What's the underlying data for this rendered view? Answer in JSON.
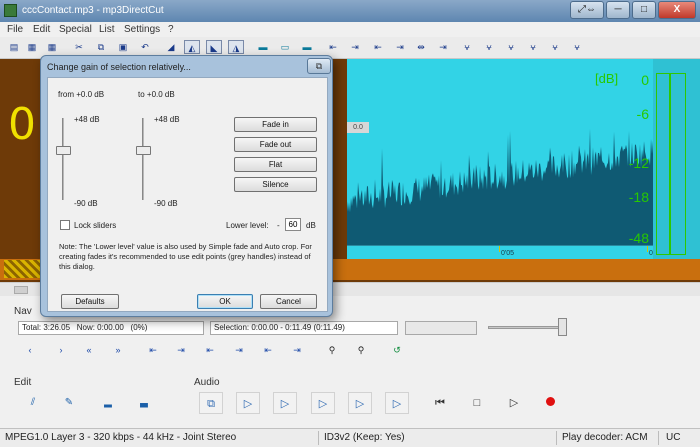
{
  "window": {
    "title": "cccContact.mp3 - mp3DirectCut",
    "btn_extra": "⤢⇔",
    "btn_min": "─",
    "btn_max": "□",
    "btn_close": "X"
  },
  "menu": [
    "File",
    "Edit",
    "Special",
    "List",
    "Settings",
    "?"
  ],
  "editor": {
    "big_time": "0",
    "db_title": "[dB]",
    "db_values": [
      "0",
      "-6",
      "-12",
      "-18",
      "-48"
    ],
    "playhead_label": "0.0",
    "timeline_labels": [
      "0'05",
      "0'10"
    ]
  },
  "nav": {
    "label": "Nav",
    "total": "Total: 3:26.05",
    "now": "Now: 0:00.00",
    "percent": "(0%)",
    "selection": "Selection: 0:00.00 - 0:11.49 (0:11.49)",
    "volume_level": 0.95
  },
  "groups": {
    "edit": "Edit",
    "audio": "Audio"
  },
  "status": {
    "format": "MPEG1.0 Layer 3 - 320 kbps - 44 kHz - Joint Stereo",
    "id3": "ID3v2 (Keep: Yes)",
    "decoder": "Play decoder: ACM",
    "flag": "UC"
  },
  "dialog": {
    "title": "Change gain of selection relatively...",
    "close": "⧉",
    "from_label": "from +0.0 dB",
    "to_label": "to +0.0 dB",
    "from_max": "+48 dB",
    "from_min": "-90 dB",
    "to_max": "+48 dB",
    "to_min": "-90 dB",
    "fade_in": "Fade in",
    "fade_out": "Fade out",
    "flat": "Flat",
    "silence": "Silence",
    "lock_sliders": "Lock sliders",
    "lower_level_label": "Lower level:",
    "lower_level_sign": "-",
    "lower_level_value": "60",
    "lower_level_unit": "dB",
    "note": "Note: The 'Lower level' value is also used by Simple fade and Auto crop. For creating fades it's recommended to use edit points (grey handles) instead of this dialog.",
    "defaults": "Defaults",
    "ok": "OK",
    "cancel": "Cancel"
  }
}
